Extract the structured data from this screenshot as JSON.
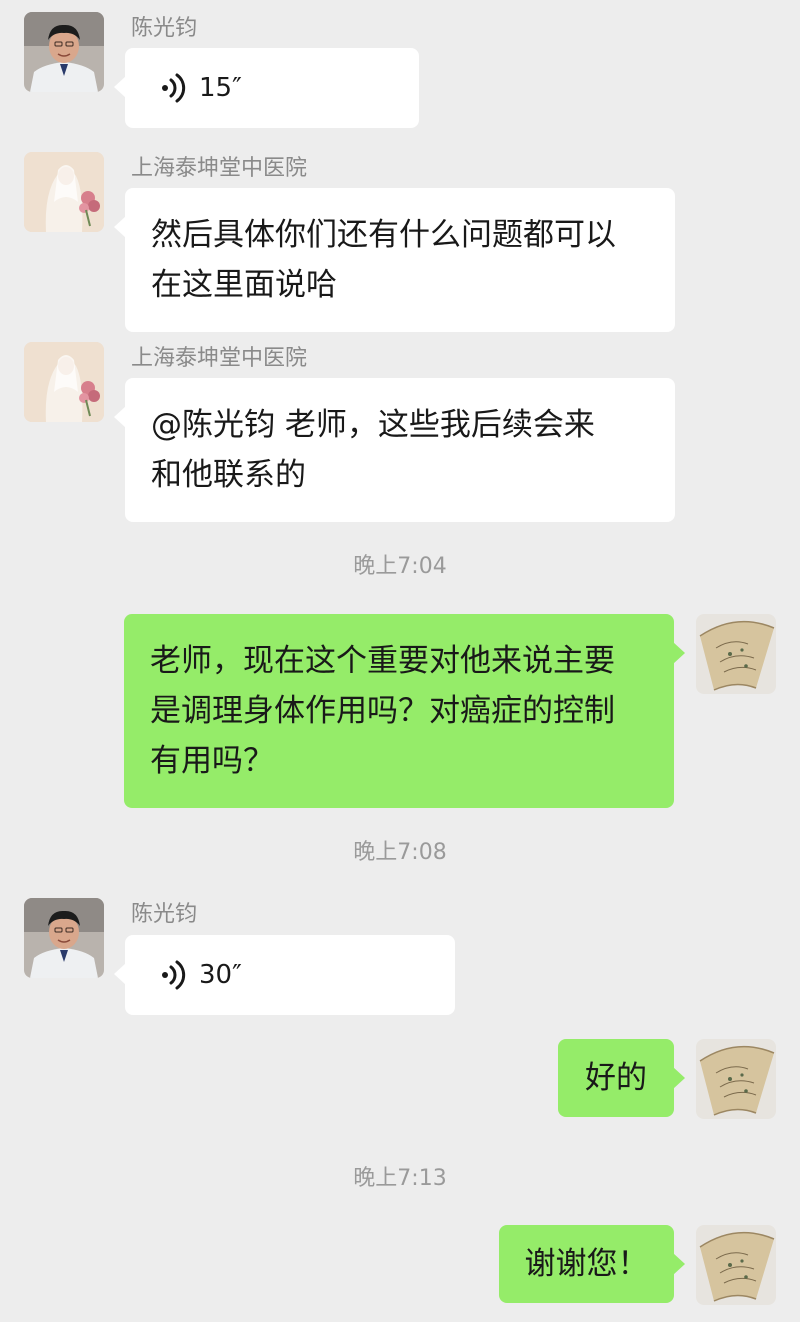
{
  "messages": {
    "m1": {
      "sender": "陈光钧",
      "duration": "15″"
    },
    "m2": {
      "sender": "上海泰坤堂中医院",
      "line1": "然后具体你们还有什么问题都可以",
      "line2": "在这里面说哈"
    },
    "m3": {
      "sender": "上海泰坤堂中医院",
      "line1": "@陈光钧  老师，这些我后续会来",
      "line2": "和他联系的"
    },
    "t1": "晚上7:04",
    "m4": {
      "line1": "老师，现在这个重要对他来说主要",
      "line2": "是调理身体作用吗？对癌症的控制",
      "line3": "有用吗？"
    },
    "t2": "晚上7:08",
    "m5": {
      "sender": "陈光钧",
      "duration": "30″"
    },
    "m6": {
      "text": "好的"
    },
    "t3": "晚上7:13",
    "m7": {
      "text": "谢谢您！"
    }
  },
  "icons": {
    "voice": "voice-wave-icon",
    "doctor_avatar": "doctor-portrait-avatar",
    "hospital_avatar": "bride-flowers-avatar",
    "self_avatar": "painted-fan-avatar"
  },
  "colors": {
    "background": "#ededed",
    "incoming_bubble": "#ffffff",
    "outgoing_bubble": "#95ec69",
    "sender_name": "#8a8a8a",
    "timestamp": "#9a9a9a"
  }
}
